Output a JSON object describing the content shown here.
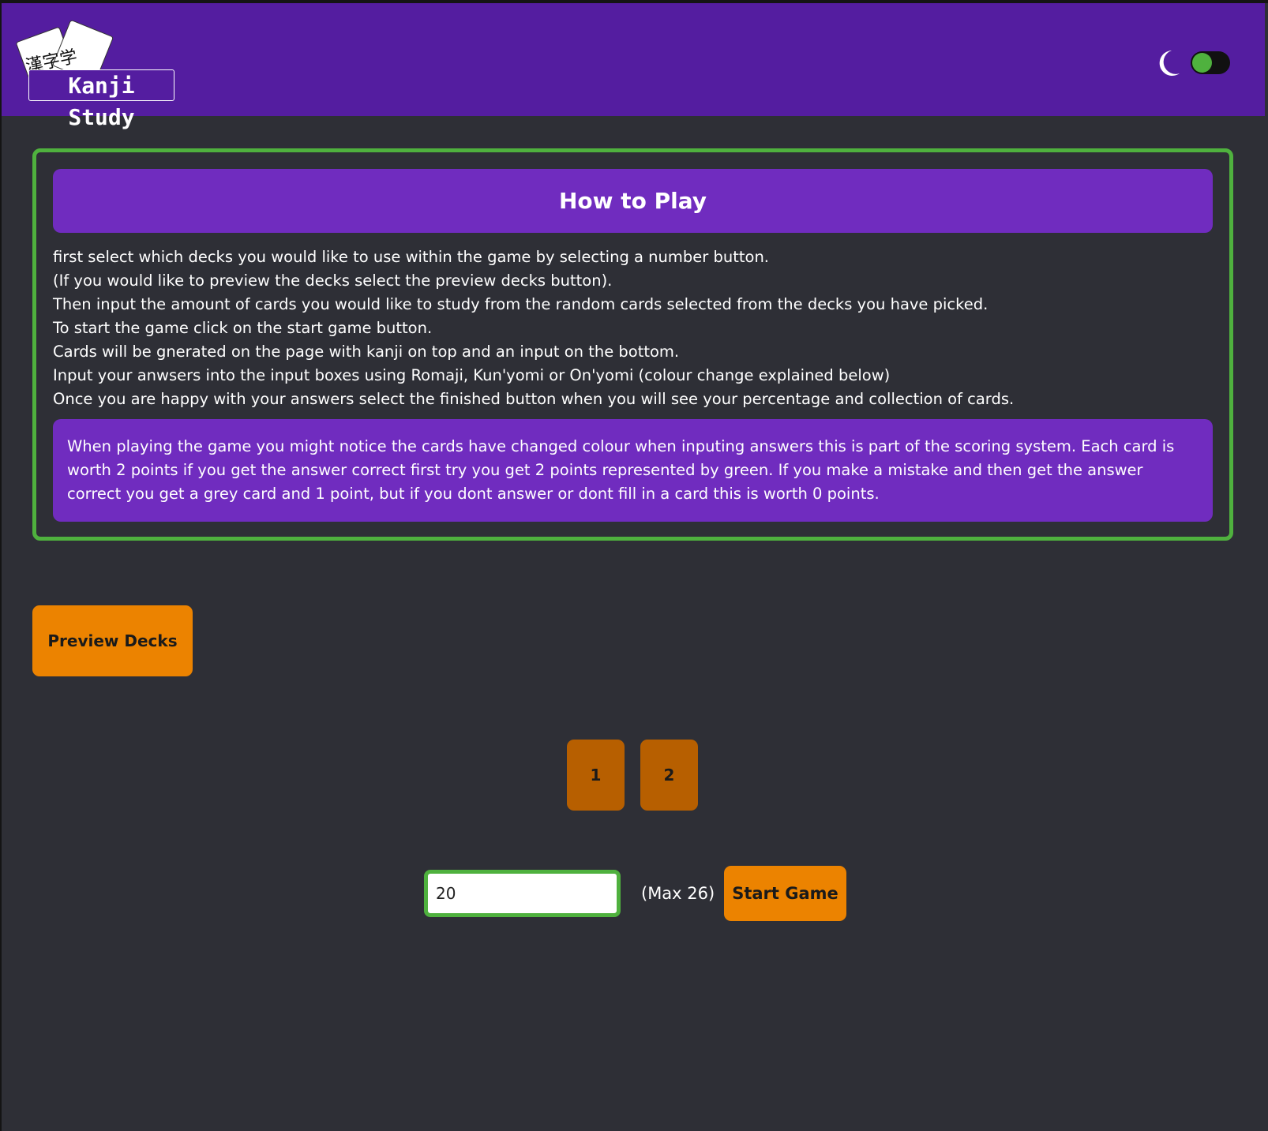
{
  "header": {
    "logo_kanji": "漢字学",
    "logo_title": "Kanji Study",
    "theme_toggle": {
      "icon": "moon-icon",
      "enabled": true
    }
  },
  "howto": {
    "title": "How to Play",
    "lines": [
      "first select which decks you would like to use within the game by selecting a number button.",
      "(If you would like to preview the decks select the preview decks button).",
      "Then input the amount of cards you would like to study from the random cards selected from the decks you have picked.",
      "To start the game click on the start game button.",
      "Cards will be gnerated on the page with kanji on top and an input on the bottom.",
      "Input your anwsers into the input boxes using Romaji, Kun'yomi or On'yomi (colour change explained below)",
      "Once you are happy with your answers select the finished button when you will see your percentage and collection of cards."
    ],
    "scoring": "When playing the game you might notice the cards have changed colour when inputing answers this is part of the scoring system. Each card is worth 2 points if you get the answer correct first try you get 2 points represented by green. If you make a mistake and then get the answer correct you get a grey card and 1 point, but if you dont answer or dont fill in a card this is worth 0 points."
  },
  "controls": {
    "preview_label": "Preview Decks",
    "decks": [
      "1",
      "2"
    ],
    "card_count_value": "20",
    "max_label": "(Max 26)",
    "start_label": "Start Game"
  },
  "colors": {
    "header": "#541da0",
    "panel_purple": "#702cbf",
    "accent_green": "#4fb13e",
    "button_orange": "#ec8300",
    "deck_orange": "#b75f00",
    "background": "#2e2f36"
  }
}
